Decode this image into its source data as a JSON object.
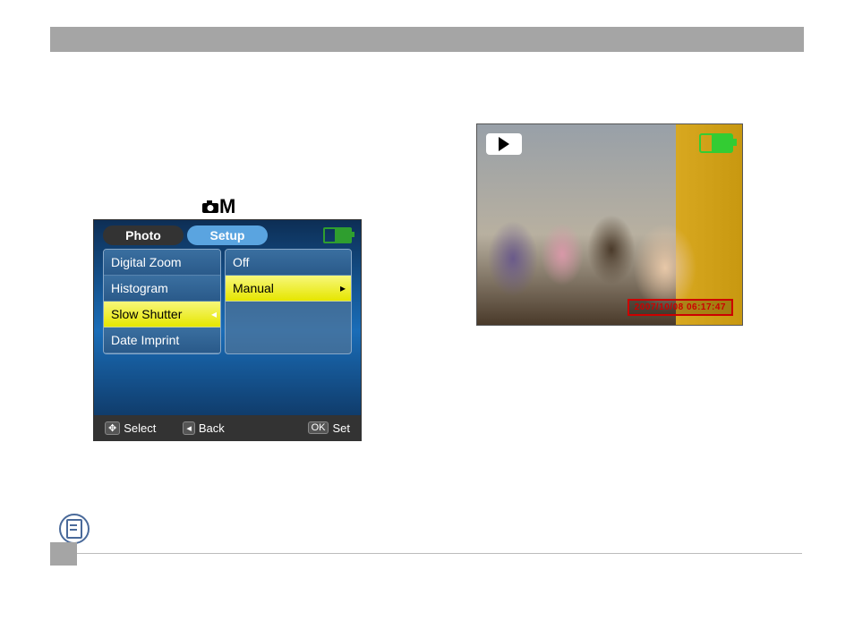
{
  "header": {
    "bar": ""
  },
  "mode_label": "M",
  "menu": {
    "tabs": {
      "photo": "Photo",
      "setup": "Setup"
    },
    "left_items": [
      "Digital Zoom",
      "Histogram",
      "Slow Shutter",
      "Date Imprint"
    ],
    "right_items": [
      "Off",
      "Manual"
    ],
    "footer": {
      "select": "Select",
      "back": "Back",
      "set": "Set",
      "ok_label": "OK"
    }
  },
  "preview": {
    "timestamp": "2007/10/08 06:17:47"
  }
}
